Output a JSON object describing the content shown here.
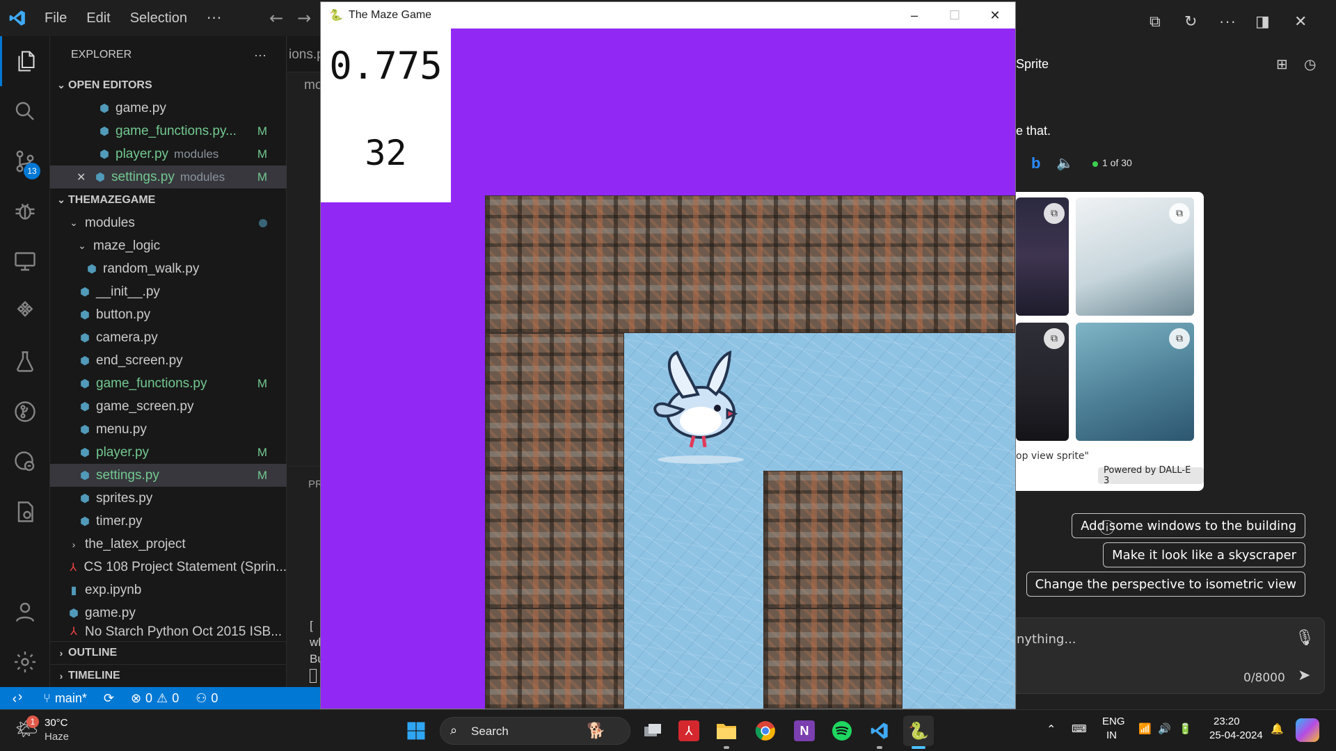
{
  "vscode": {
    "menu": [
      "File",
      "Edit",
      "Selection"
    ],
    "more": "···",
    "explorer_title": "EXPLORER",
    "explorer_more": "···",
    "partial_tab_1": "ions.p",
    "partial_tab_2": "mo",
    "partial_panel": "PR",
    "partial_lines": [
      "[",
      "wh",
      "Bu"
    ],
    "scm_badge": "13",
    "open_editors": {
      "title": "OPEN EDITORS",
      "items": [
        {
          "name": "game.py",
          "dir": "",
          "flag": ""
        },
        {
          "name": "game_functions.py...",
          "dir": "",
          "flag": "M"
        },
        {
          "name": "player.py",
          "dir": "modules",
          "flag": "M"
        },
        {
          "name": "settings.py",
          "dir": "modules",
          "flag": "M"
        }
      ]
    },
    "project": {
      "title": "THEMAZEGAME",
      "modules": "modules",
      "maze_logic": "maze_logic",
      "files": [
        {
          "name": "random_walk.py",
          "flag": ""
        },
        {
          "name": "__init__.py",
          "flag": ""
        },
        {
          "name": "button.py",
          "flag": ""
        },
        {
          "name": "camera.py",
          "flag": ""
        },
        {
          "name": "end_screen.py",
          "flag": ""
        },
        {
          "name": "game_functions.py",
          "flag": "M"
        },
        {
          "name": "game_screen.py",
          "flag": ""
        },
        {
          "name": "menu.py",
          "flag": ""
        },
        {
          "name": "player.py",
          "flag": "M"
        },
        {
          "name": "settings.py",
          "flag": "M"
        },
        {
          "name": "sprites.py",
          "flag": ""
        },
        {
          "name": "timer.py",
          "flag": ""
        }
      ],
      "latex": "the_latex_project",
      "root_files": [
        "CS 108 Project Statement (Sprin...",
        "exp.ipynb",
        "game.py",
        "No Starch Python Oct 2015 ISB..."
      ]
    },
    "outline": "OUTLINE",
    "timeline": "TIMELINE",
    "status": {
      "branch": "main*",
      "errors": "0",
      "warnings": "0",
      "ports": "0"
    }
  },
  "game": {
    "title": "The Maze Game",
    "timer": "0.775",
    "score": "32",
    "colors": {
      "background": "#9128f4",
      "ice": "#8fc3e4",
      "wall": "#6d5a4c"
    }
  },
  "copilot": {
    "heading_partial": "Sprite",
    "message_partial": "e that.",
    "counter": "1 of 30",
    "caption_partial": "op view sprite\"",
    "powered": "Powered by DALL-E 3",
    "suggestions": [
      "Add some windows to the building",
      "Make it look like a skyscraper",
      "Change the perspective to isometric view"
    ],
    "input_placeholder": "nything...",
    "char_count": "0/8000"
  },
  "taskbar": {
    "weather_temp": "30°C",
    "weather_desc": "Haze",
    "weather_badge": "1",
    "search": "Search",
    "lang1": "ENG",
    "lang2": "IN",
    "time": "23:20",
    "date": "25-04-2024"
  }
}
